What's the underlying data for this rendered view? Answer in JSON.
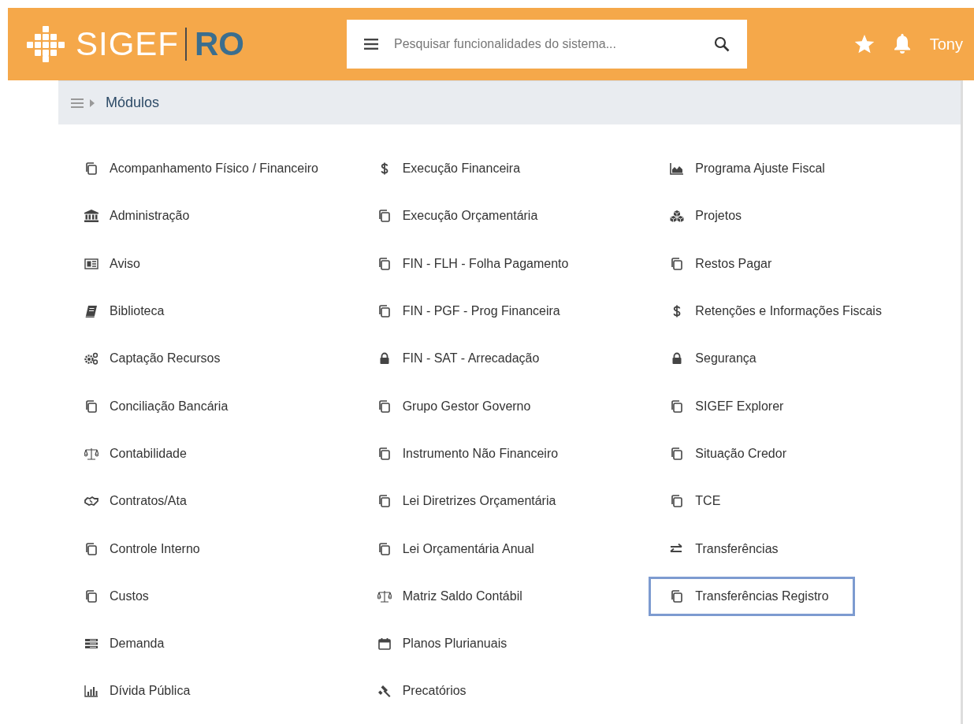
{
  "header": {
    "logo_left": "SIGEF",
    "logo_right": "RO",
    "search": {
      "placeholder": "Pesquisar funcionalidades do sistema..."
    },
    "user": "Tony"
  },
  "breadcrumb": {
    "title": "Módulos"
  },
  "columns": [
    [
      {
        "label": "Acompanhamento Físico / Financeiro",
        "kind": "copy",
        "selected": false
      },
      {
        "label": "Administração",
        "kind": "bank",
        "selected": false
      },
      {
        "label": "Aviso",
        "kind": "newspaper",
        "selected": false
      },
      {
        "label": "Biblioteca",
        "kind": "book",
        "selected": false
      },
      {
        "label": "Captação Recursos",
        "kind": "gears",
        "selected": false
      },
      {
        "label": "Conciliação Bancária",
        "kind": "copy",
        "selected": false
      },
      {
        "label": "Contabilidade",
        "kind": "scale",
        "selected": false
      },
      {
        "label": "Contratos/Ata",
        "kind": "handshake",
        "selected": false
      },
      {
        "label": "Controle Interno",
        "kind": "copy",
        "selected": false
      },
      {
        "label": "Custos",
        "kind": "copy",
        "selected": false
      },
      {
        "label": "Demanda",
        "kind": "list",
        "selected": false
      },
      {
        "label": "Dívida Pública",
        "kind": "bars",
        "selected": false
      }
    ],
    [
      {
        "label": "Execução Financeira",
        "kind": "dollar",
        "selected": false
      },
      {
        "label": "Execução Orçamentária",
        "kind": "copy",
        "selected": false
      },
      {
        "label": "FIN - FLH - Folha Pagamento",
        "kind": "copy",
        "selected": false
      },
      {
        "label": "FIN - PGF - Prog Financeira",
        "kind": "copy",
        "selected": false
      },
      {
        "label": "FIN - SAT - Arrecadação",
        "kind": "lock",
        "selected": false
      },
      {
        "label": "Grupo Gestor Governo",
        "kind": "copy",
        "selected": false
      },
      {
        "label": "Instrumento Não Financeiro",
        "kind": "copy",
        "selected": false
      },
      {
        "label": "Lei Diretrizes Orçamentária",
        "kind": "copy",
        "selected": false
      },
      {
        "label": "Lei Orçamentária Anual",
        "kind": "copy",
        "selected": false
      },
      {
        "label": "Matriz Saldo Contábil",
        "kind": "scale",
        "selected": false
      },
      {
        "label": "Planos Plurianuais",
        "kind": "calendar",
        "selected": false
      },
      {
        "label": "Precatórios",
        "kind": "gavel",
        "selected": false
      }
    ],
    [
      {
        "label": "Programa Ajuste Fiscal",
        "kind": "area",
        "selected": false
      },
      {
        "label": "Projetos",
        "kind": "cubes",
        "selected": false
      },
      {
        "label": "Restos Pagar",
        "kind": "copy",
        "selected": false
      },
      {
        "label": "Retenções e Informações Fiscais",
        "kind": "dollar",
        "selected": false
      },
      {
        "label": "Segurança",
        "kind": "lock",
        "selected": false
      },
      {
        "label": "SIGEF Explorer",
        "kind": "copy",
        "selected": false
      },
      {
        "label": "Situação Credor",
        "kind": "copy",
        "selected": false
      },
      {
        "label": "TCE",
        "kind": "copy",
        "selected": false
      },
      {
        "label": "Transferências",
        "kind": "exchange",
        "selected": false
      },
      {
        "label": "Transferências Registro",
        "kind": "copy",
        "selected": true
      }
    ]
  ]
}
